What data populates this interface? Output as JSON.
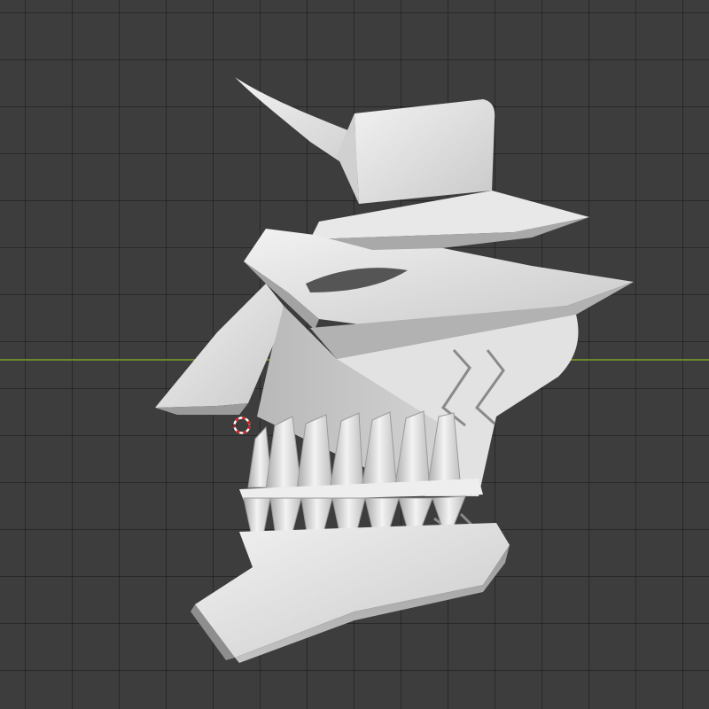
{
  "viewport": {
    "background_color": "#3d3d3d",
    "grid_line_color": "#2f2f2f",
    "x_axis_color": "#6a8a2c"
  },
  "model": {
    "icon": "hollow-mask-3d-model",
    "base_color": "#d9d9d9",
    "shadow_color": "#8f8f8f"
  },
  "cursor": {
    "icon": "3d-cursor-icon",
    "colors": [
      "#e02020",
      "#ffffff"
    ]
  }
}
